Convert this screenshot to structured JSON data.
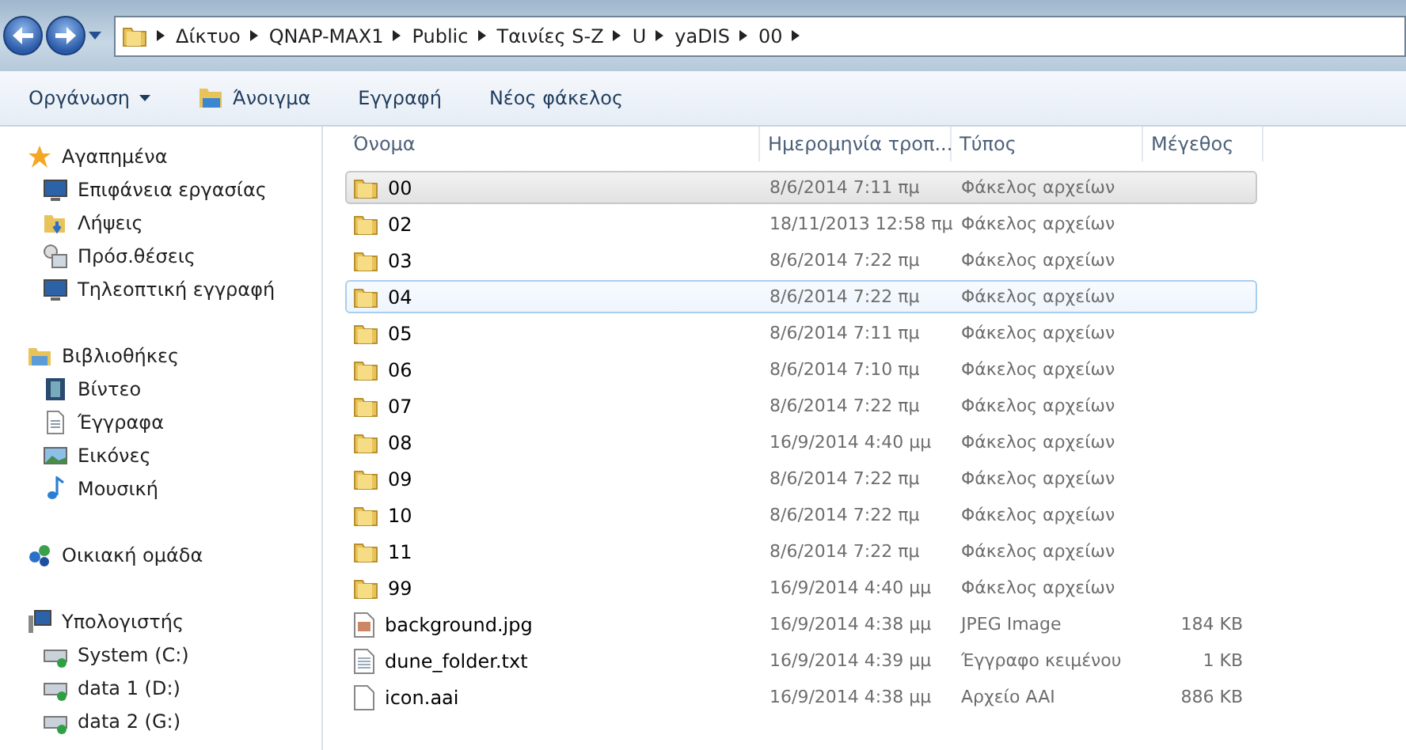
{
  "breadcrumb": [
    "Δίκτυο",
    "QNAP-MAX1",
    "Public",
    "Ταινίες S-Z",
    "U",
    "yaDIS",
    "00"
  ],
  "toolbar": [
    {
      "label": "Οργάνωση",
      "kind": "menu"
    },
    {
      "label": "Άνοιγμα",
      "kind": "open"
    },
    {
      "label": "Εγγραφή",
      "kind": "plain"
    },
    {
      "label": "Νέος φάκελος",
      "kind": "plain"
    }
  ],
  "sidebar": [
    {
      "label": "Αγαπημένα",
      "kind": "star",
      "children": [
        {
          "label": "Επιφάνεια εργασίας",
          "kind": "desktop"
        },
        {
          "label": "Λήψεις",
          "kind": "downloads"
        },
        {
          "label": "Πρόσ.θέσεις",
          "kind": "recent"
        },
        {
          "label": "Τηλεοπτική εγγραφή",
          "kind": "monitor"
        }
      ]
    },
    {
      "label": "Βιβλιοθήκες",
      "kind": "library",
      "children": [
        {
          "label": "Βίντεο",
          "kind": "video"
        },
        {
          "label": "Έγγραφα",
          "kind": "document"
        },
        {
          "label": "Εικόνες",
          "kind": "image"
        },
        {
          "label": "Μουσική",
          "kind": "music"
        }
      ]
    },
    {
      "label": "Οικιακή ομάδα",
      "kind": "homegroup"
    },
    {
      "label": "Υπολογιστής",
      "kind": "computer",
      "children": [
        {
          "label": "System (C:)",
          "kind": "drive"
        },
        {
          "label": "data 1 (D:)",
          "kind": "drive"
        },
        {
          "label": "data 2 (G:)",
          "kind": "drive"
        }
      ]
    }
  ],
  "columns": [
    "Όνομα",
    "Ημερομηνία τροπ...",
    "Τύπος",
    "Μέγεθος"
  ],
  "rows": [
    {
      "name": "00",
      "date": "8/6/2014 7:11 πμ",
      "type": "Φάκελος αρχείων",
      "kind": "folder",
      "selected": true,
      "hovered": false
    },
    {
      "name": "02",
      "date": "18/11/2013 12:58 πμ",
      "type": "Φάκελος αρχείων",
      "kind": "folder",
      "selected": false,
      "hovered": false
    },
    {
      "name": "03",
      "date": "8/6/2014 7:22 πμ",
      "type": "Φάκελος αρχείων",
      "kind": "folder",
      "selected": false,
      "hovered": false
    },
    {
      "name": "04",
      "date": "8/6/2014 7:22 πμ",
      "type": "Φάκελος αρχείων",
      "kind": "folder",
      "selected": false,
      "hovered": true
    },
    {
      "name": "05",
      "date": "8/6/2014 7:11 πμ",
      "type": "Φάκελος αρχείων",
      "kind": "folder",
      "selected": false,
      "hovered": false
    },
    {
      "name": "06",
      "date": "8/6/2014 7:10 πμ",
      "type": "Φάκελος αρχείων",
      "kind": "folder",
      "selected": false,
      "hovered": false
    },
    {
      "name": "07",
      "date": "8/6/2014 7:22 πμ",
      "type": "Φάκελος αρχείων",
      "kind": "folder",
      "selected": false,
      "hovered": false
    },
    {
      "name": "08",
      "date": "16/9/2014 4:40 μμ",
      "type": "Φάκελος αρχείων",
      "kind": "folder",
      "selected": false,
      "hovered": false
    },
    {
      "name": "09",
      "date": "8/6/2014 7:22 πμ",
      "type": "Φάκελος αρχείων",
      "kind": "folder",
      "selected": false,
      "hovered": false
    },
    {
      "name": "10",
      "date": "8/6/2014 7:22 πμ",
      "type": "Φάκελος αρχείων",
      "kind": "folder",
      "selected": false,
      "hovered": false
    },
    {
      "name": "11",
      "date": "8/6/2014 7:22 πμ",
      "type": "Φάκελος αρχείων",
      "kind": "folder",
      "selected": false,
      "hovered": false
    },
    {
      "name": "99",
      "date": "16/9/2014 4:40 μμ",
      "type": "Φάκελος αρχείων",
      "kind": "folder",
      "selected": false,
      "hovered": false
    },
    {
      "name": "background.jpg",
      "date": "16/9/2014 4:38 μμ",
      "type": "JPEG Image",
      "size": "184 KB",
      "kind": "image",
      "selected": false,
      "hovered": false
    },
    {
      "name": "dune_folder.txt",
      "date": "16/9/2014 4:39 μμ",
      "type": "Έγγραφο κειμένου",
      "size": "1 KB",
      "kind": "text",
      "selected": false,
      "hovered": false
    },
    {
      "name": "icon.aai",
      "date": "16/9/2014 4:38 μμ",
      "type": "Αρχείο AAI",
      "size": "886 KB",
      "kind": "file",
      "selected": false,
      "hovered": false
    }
  ]
}
